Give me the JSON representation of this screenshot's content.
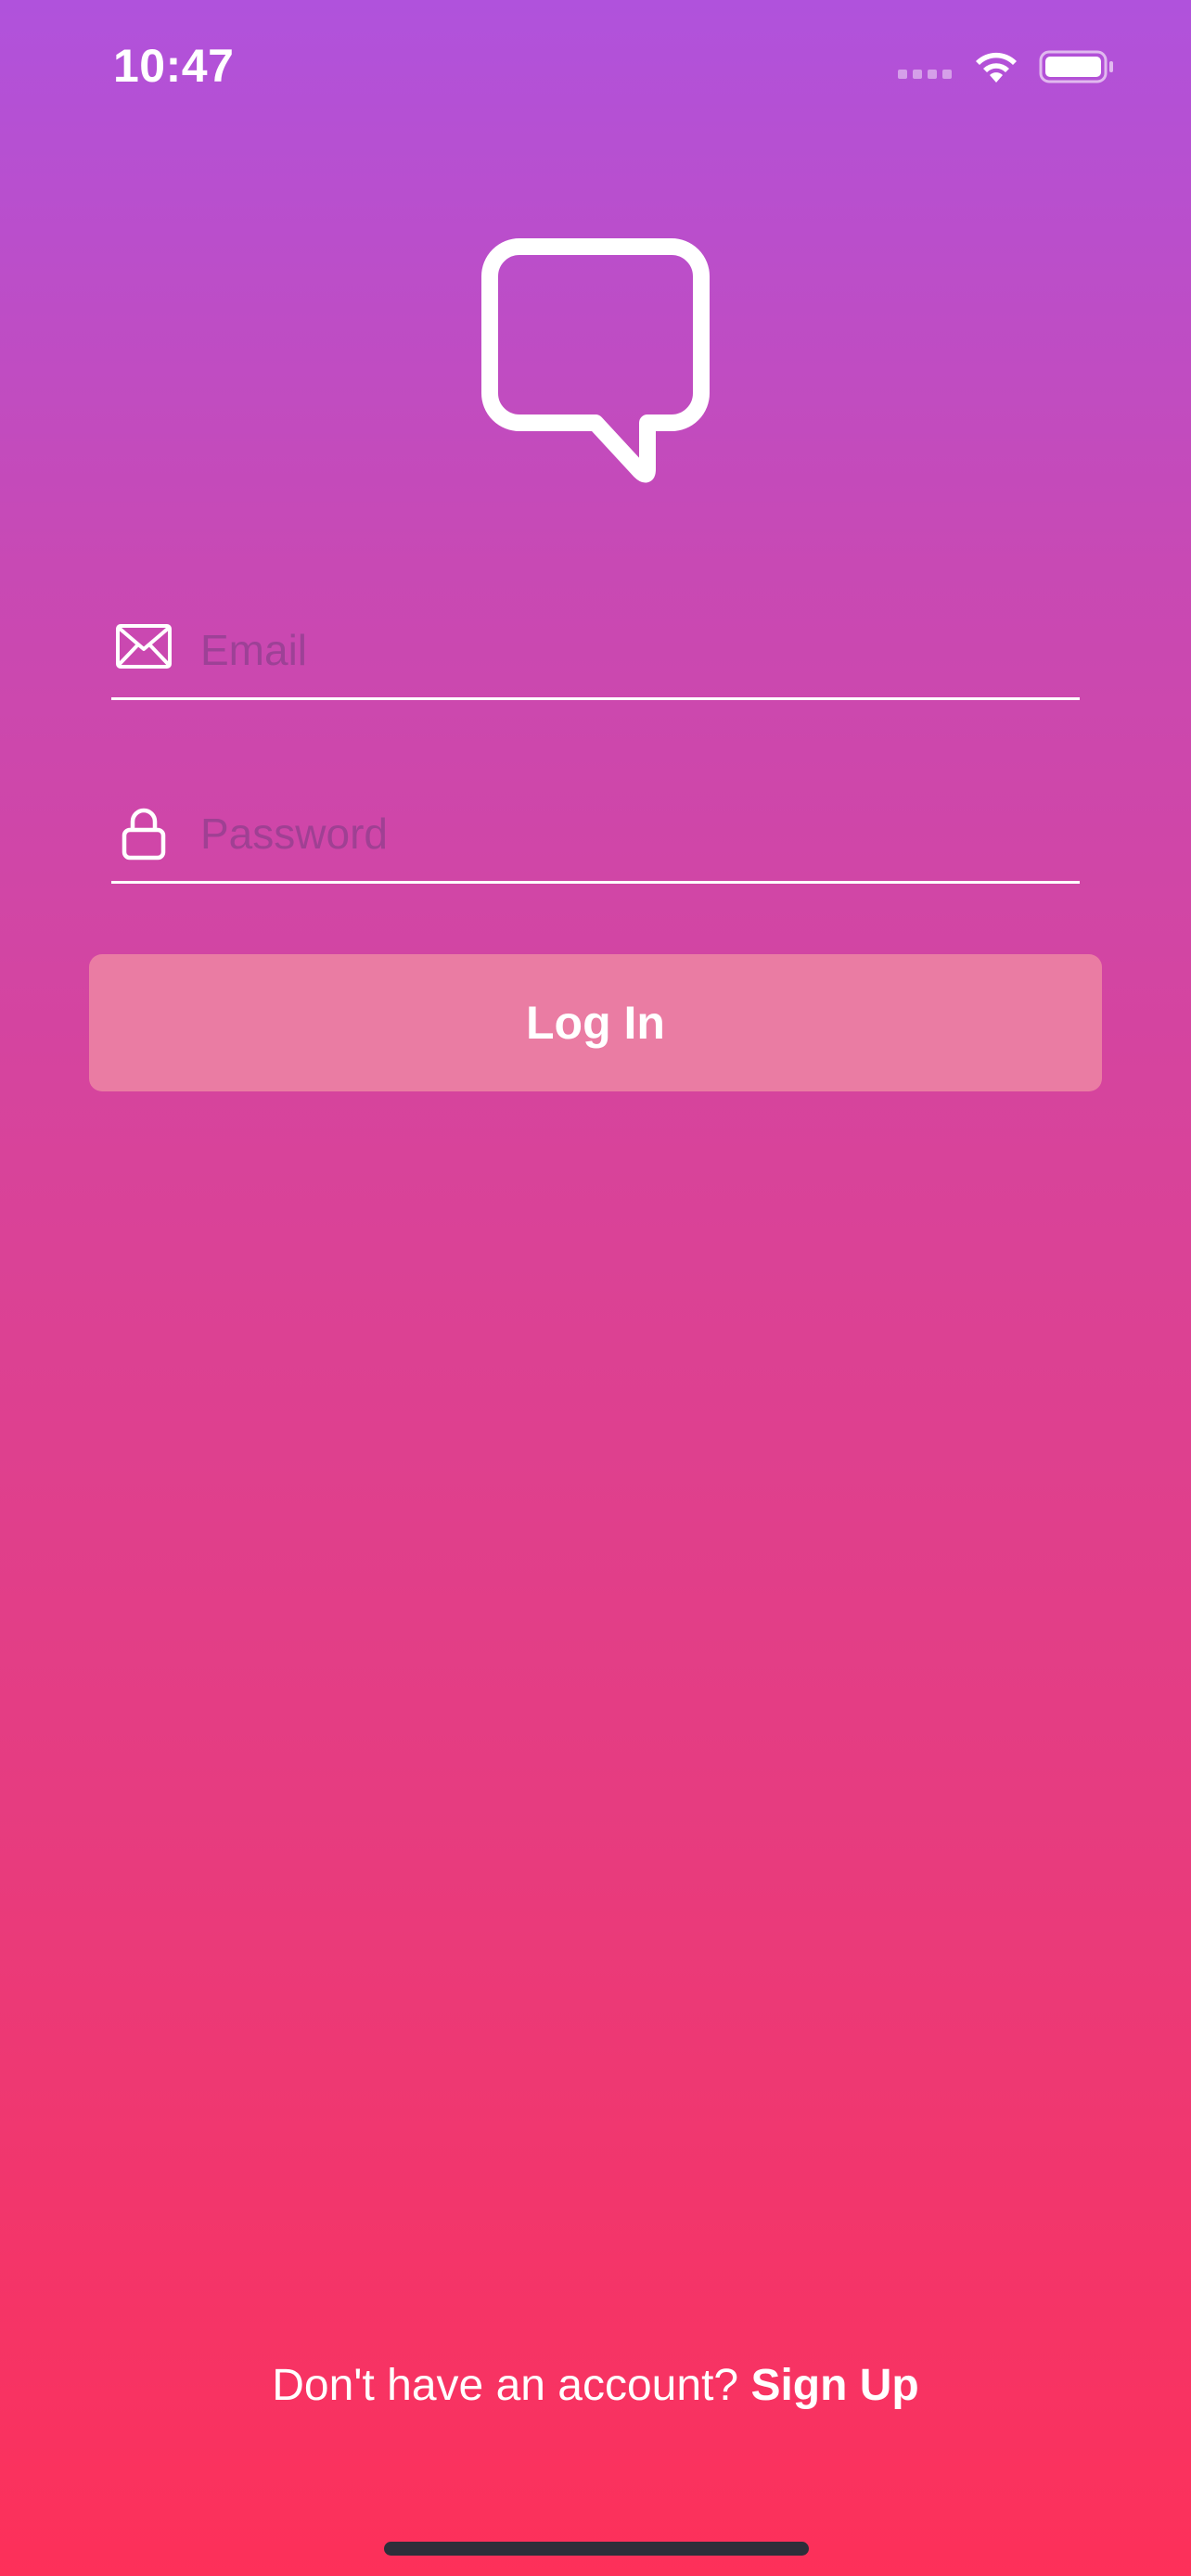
{
  "status_bar": {
    "time": "10:47",
    "icons": [
      "signal-dots-icon",
      "wifi-icon",
      "battery-icon"
    ]
  },
  "logo": {
    "icon": "speech-bubble-icon"
  },
  "form": {
    "email": {
      "icon": "envelope-icon",
      "placeholder": "Email",
      "value": ""
    },
    "password": {
      "icon": "lock-icon",
      "placeholder": "Password",
      "value": ""
    },
    "login_label": "Log In"
  },
  "footer": {
    "prompt": "Don't have an account?",
    "signup_label": "Sign Up"
  },
  "colors": {
    "gradient_top": "#b052dc",
    "gradient_bottom": "#fd3059",
    "button_bg": "#ea7ca3",
    "text": "#ffffff"
  }
}
